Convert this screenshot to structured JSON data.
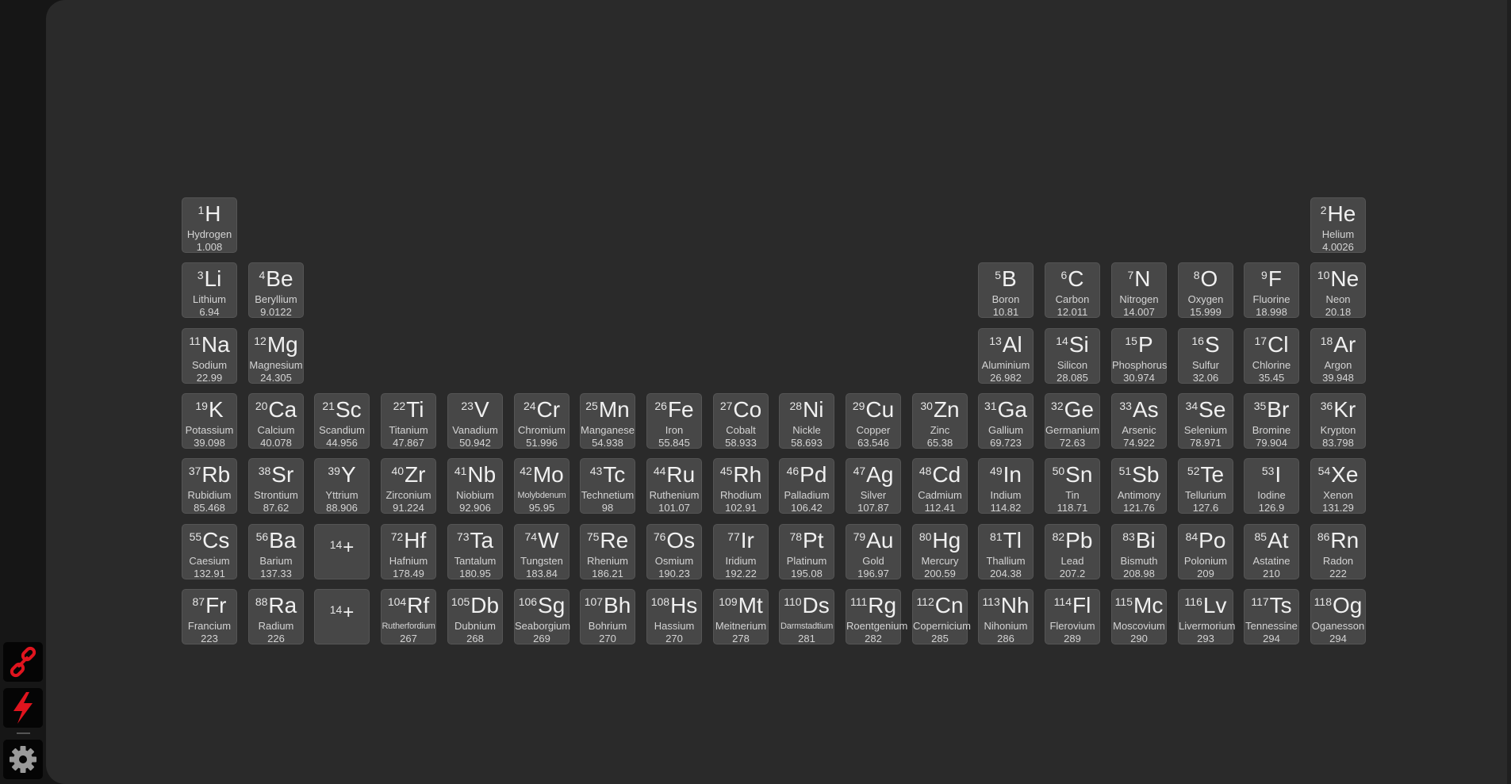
{
  "sidebar": {
    "buttons": [
      {
        "name": "link-button",
        "icon": "link-icon",
        "color": "#e0141e"
      },
      {
        "name": "flash-button",
        "icon": "lightning-icon",
        "color": "#e0141e"
      },
      {
        "name": "settings-button",
        "icon": "gear-icon",
        "color": "#9a9a9a"
      }
    ]
  },
  "colors": {
    "tile_bg": "#474747",
    "page_bg": "#2a2a2a",
    "sidebar_bg": "#161616",
    "accent": "#e0141e"
  },
  "elements": [
    {
      "n": "1",
      "s": "H",
      "name": "Hydrogen",
      "m": "1.008",
      "r": 1,
      "c": 1
    },
    {
      "n": "2",
      "s": "He",
      "name": "Helium",
      "m": "4.0026",
      "r": 1,
      "c": 18
    },
    {
      "n": "3",
      "s": "Li",
      "name": "Lithium",
      "m": "6.94",
      "r": 2,
      "c": 1
    },
    {
      "n": "4",
      "s": "Be",
      "name": "Beryllium",
      "m": "9.0122",
      "r": 2,
      "c": 2
    },
    {
      "n": "5",
      "s": "B",
      "name": "Boron",
      "m": "10.81",
      "r": 2,
      "c": 13
    },
    {
      "n": "6",
      "s": "C",
      "name": "Carbon",
      "m": "12.011",
      "r": 2,
      "c": 14
    },
    {
      "n": "7",
      "s": "N",
      "name": "Nitrogen",
      "m": "14.007",
      "r": 2,
      "c": 15
    },
    {
      "n": "8",
      "s": "O",
      "name": "Oxygen",
      "m": "15.999",
      "r": 2,
      "c": 16
    },
    {
      "n": "9",
      "s": "F",
      "name": "Fluorine",
      "m": "18.998",
      "r": 2,
      "c": 17
    },
    {
      "n": "10",
      "s": "Ne",
      "name": "Neon",
      "m": "20.18",
      "r": 2,
      "c": 18
    },
    {
      "n": "11",
      "s": "Na",
      "name": "Sodium",
      "m": "22.99",
      "r": 3,
      "c": 1
    },
    {
      "n": "12",
      "s": "Mg",
      "name": "Magnesium",
      "m": "24.305",
      "r": 3,
      "c": 2
    },
    {
      "n": "13",
      "s": "Al",
      "name": "Aluminium",
      "m": "26.982",
      "r": 3,
      "c": 13
    },
    {
      "n": "14",
      "s": "Si",
      "name": "Silicon",
      "m": "28.085",
      "r": 3,
      "c": 14
    },
    {
      "n": "15",
      "s": "P",
      "name": "Phosphorus",
      "m": "30.974",
      "r": 3,
      "c": 15
    },
    {
      "n": "16",
      "s": "S",
      "name": "Sulfur",
      "m": "32.06",
      "r": 3,
      "c": 16
    },
    {
      "n": "17",
      "s": "Cl",
      "name": "Chlorine",
      "m": "35.45",
      "r": 3,
      "c": 17
    },
    {
      "n": "18",
      "s": "Ar",
      "name": "Argon",
      "m": "39.948",
      "r": 3,
      "c": 18
    },
    {
      "n": "19",
      "s": "K",
      "name": "Potassium",
      "m": "39.098",
      "r": 4,
      "c": 1
    },
    {
      "n": "20",
      "s": "Ca",
      "name": "Calcium",
      "m": "40.078",
      "r": 4,
      "c": 2
    },
    {
      "n": "21",
      "s": "Sc",
      "name": "Scandium",
      "m": "44.956",
      "r": 4,
      "c": 3
    },
    {
      "n": "22",
      "s": "Ti",
      "name": "Titanium",
      "m": "47.867",
      "r": 4,
      "c": 4
    },
    {
      "n": "23",
      "s": "V",
      "name": "Vanadium",
      "m": "50.942",
      "r": 4,
      "c": 5
    },
    {
      "n": "24",
      "s": "Cr",
      "name": "Chromium",
      "m": "51.996",
      "r": 4,
      "c": 6
    },
    {
      "n": "25",
      "s": "Mn",
      "name": "Manganese",
      "m": "54.938",
      "r": 4,
      "c": 7
    },
    {
      "n": "26",
      "s": "Fe",
      "name": "Iron",
      "m": "55.845",
      "r": 4,
      "c": 8
    },
    {
      "n": "27",
      "s": "Co",
      "name": "Cobalt",
      "m": "58.933",
      "r": 4,
      "c": 9
    },
    {
      "n": "28",
      "s": "Ni",
      "name": "Nickle",
      "m": "58.693",
      "r": 4,
      "c": 10
    },
    {
      "n": "29",
      "s": "Cu",
      "name": "Copper",
      "m": "63.546",
      "r": 4,
      "c": 11
    },
    {
      "n": "30",
      "s": "Zn",
      "name": "Zinc",
      "m": "65.38",
      "r": 4,
      "c": 12
    },
    {
      "n": "31",
      "s": "Ga",
      "name": "Gallium",
      "m": "69.723",
      "r": 4,
      "c": 13
    },
    {
      "n": "32",
      "s": "Ge",
      "name": "Germanium",
      "m": "72.63",
      "r": 4,
      "c": 14
    },
    {
      "n": "33",
      "s": "As",
      "name": "Arsenic",
      "m": "74.922",
      "r": 4,
      "c": 15
    },
    {
      "n": "34",
      "s": "Se",
      "name": "Selenium",
      "m": "78.971",
      "r": 4,
      "c": 16
    },
    {
      "n": "35",
      "s": "Br",
      "name": "Bromine",
      "m": "79.904",
      "r": 4,
      "c": 17
    },
    {
      "n": "36",
      "s": "Kr",
      "name": "Krypton",
      "m": "83.798",
      "r": 4,
      "c": 18
    },
    {
      "n": "37",
      "s": "Rb",
      "name": "Rubidium",
      "m": "85.468",
      "r": 5,
      "c": 1
    },
    {
      "n": "38",
      "s": "Sr",
      "name": "Strontium",
      "m": "87.62",
      "r": 5,
      "c": 2
    },
    {
      "n": "39",
      "s": "Y",
      "name": "Yttrium",
      "m": "88.906",
      "r": 5,
      "c": 3
    },
    {
      "n": "40",
      "s": "Zr",
      "name": "Zirconium",
      "m": "91.224",
      "r": 5,
      "c": 4
    },
    {
      "n": "41",
      "s": "Nb",
      "name": "Niobium",
      "m": "92.906",
      "r": 5,
      "c": 5
    },
    {
      "n": "42",
      "s": "Mo",
      "name": "Molybdenum",
      "m": "95.95",
      "r": 5,
      "c": 6,
      "small": true
    },
    {
      "n": "43",
      "s": "Tc",
      "name": "Technetium",
      "m": "98",
      "r": 5,
      "c": 7
    },
    {
      "n": "44",
      "s": "Ru",
      "name": "Ruthenium",
      "m": "101.07",
      "r": 5,
      "c": 8
    },
    {
      "n": "45",
      "s": "Rh",
      "name": "Rhodium",
      "m": "102.91",
      "r": 5,
      "c": 9
    },
    {
      "n": "46",
      "s": "Pd",
      "name": "Palladium",
      "m": "106.42",
      "r": 5,
      "c": 10
    },
    {
      "n": "47",
      "s": "Ag",
      "name": "Silver",
      "m": "107.87",
      "r": 5,
      "c": 11
    },
    {
      "n": "48",
      "s": "Cd",
      "name": "Cadmium",
      "m": "112.41",
      "r": 5,
      "c": 12
    },
    {
      "n": "49",
      "s": "In",
      "name": "Indium",
      "m": "114.82",
      "r": 5,
      "c": 13
    },
    {
      "n": "50",
      "s": "Sn",
      "name": "Tin",
      "m": "118.71",
      "r": 5,
      "c": 14
    },
    {
      "n": "51",
      "s": "Sb",
      "name": "Antimony",
      "m": "121.76",
      "r": 5,
      "c": 15
    },
    {
      "n": "52",
      "s": "Te",
      "name": "Tellurium",
      "m": "127.6",
      "r": 5,
      "c": 16
    },
    {
      "n": "53",
      "s": "I",
      "name": "Iodine",
      "m": "126.9",
      "r": 5,
      "c": 17
    },
    {
      "n": "54",
      "s": "Xe",
      "name": "Xenon",
      "m": "131.29",
      "r": 5,
      "c": 18
    },
    {
      "n": "55",
      "s": "Cs",
      "name": "Caesium",
      "m": "132.91",
      "r": 6,
      "c": 1
    },
    {
      "n": "56",
      "s": "Ba",
      "name": "Barium",
      "m": "137.33",
      "r": 6,
      "c": 2
    },
    {
      "n": "14",
      "s": "+",
      "name": "",
      "m": "",
      "r": 6,
      "c": 3,
      "placeholder": true
    },
    {
      "n": "72",
      "s": "Hf",
      "name": "Hafnium",
      "m": "178.49",
      "r": 6,
      "c": 4
    },
    {
      "n": "73",
      "s": "Ta",
      "name": "Tantalum",
      "m": "180.95",
      "r": 6,
      "c": 5
    },
    {
      "n": "74",
      "s": "W",
      "name": "Tungsten",
      "m": "183.84",
      "r": 6,
      "c": 6
    },
    {
      "n": "75",
      "s": "Re",
      "name": "Rhenium",
      "m": "186.21",
      "r": 6,
      "c": 7
    },
    {
      "n": "76",
      "s": "Os",
      "name": "Osmium",
      "m": "190.23",
      "r": 6,
      "c": 8
    },
    {
      "n": "77",
      "s": "Ir",
      "name": "Iridium",
      "m": "192.22",
      "r": 6,
      "c": 9
    },
    {
      "n": "78",
      "s": "Pt",
      "name": "Platinum",
      "m": "195.08",
      "r": 6,
      "c": 10
    },
    {
      "n": "79",
      "s": "Au",
      "name": "Gold",
      "m": "196.97",
      "r": 6,
      "c": 11
    },
    {
      "n": "80",
      "s": "Hg",
      "name": "Mercury",
      "m": "200.59",
      "r": 6,
      "c": 12
    },
    {
      "n": "81",
      "s": "Tl",
      "name": "Thallium",
      "m": "204.38",
      "r": 6,
      "c": 13
    },
    {
      "n": "82",
      "s": "Pb",
      "name": "Lead",
      "m": "207.2",
      "r": 6,
      "c": 14
    },
    {
      "n": "83",
      "s": "Bi",
      "name": "Bismuth",
      "m": "208.98",
      "r": 6,
      "c": 15
    },
    {
      "n": "84",
      "s": "Po",
      "name": "Polonium",
      "m": "209",
      "r": 6,
      "c": 16
    },
    {
      "n": "85",
      "s": "At",
      "name": "Astatine",
      "m": "210",
      "r": 6,
      "c": 17
    },
    {
      "n": "86",
      "s": "Rn",
      "name": "Radon",
      "m": "222",
      "r": 6,
      "c": 18
    },
    {
      "n": "87",
      "s": "Fr",
      "name": "Francium",
      "m": "223",
      "r": 7,
      "c": 1
    },
    {
      "n": "88",
      "s": "Ra",
      "name": "Radium",
      "m": "226",
      "r": 7,
      "c": 2
    },
    {
      "n": "14",
      "s": "+",
      "name": "",
      "m": "",
      "r": 7,
      "c": 3,
      "placeholder": true
    },
    {
      "n": "104",
      "s": "Rf",
      "name": "Rutherfordium",
      "m": "267",
      "r": 7,
      "c": 4,
      "small": true
    },
    {
      "n": "105",
      "s": "Db",
      "name": "Dubnium",
      "m": "268",
      "r": 7,
      "c": 5
    },
    {
      "n": "106",
      "s": "Sg",
      "name": "Seaborgium",
      "m": "269",
      "r": 7,
      "c": 6
    },
    {
      "n": "107",
      "s": "Bh",
      "name": "Bohrium",
      "m": "270",
      "r": 7,
      "c": 7
    },
    {
      "n": "108",
      "s": "Hs",
      "name": "Hassium",
      "m": "270",
      "r": 7,
      "c": 8
    },
    {
      "n": "109",
      "s": "Mt",
      "name": "Meitnerium",
      "m": "278",
      "r": 7,
      "c": 9
    },
    {
      "n": "110",
      "s": "Ds",
      "name": "Darmstadtium",
      "m": "281",
      "r": 7,
      "c": 10,
      "small": true
    },
    {
      "n": "111",
      "s": "Rg",
      "name": "Roentgenium",
      "m": "282",
      "r": 7,
      "c": 11
    },
    {
      "n": "112",
      "s": "Cn",
      "name": "Copernicium",
      "m": "285",
      "r": 7,
      "c": 12
    },
    {
      "n": "113",
      "s": "Nh",
      "name": "Nihonium",
      "m": "286",
      "r": 7,
      "c": 13
    },
    {
      "n": "114",
      "s": "Fl",
      "name": "Flerovium",
      "m": "289",
      "r": 7,
      "c": 14
    },
    {
      "n": "115",
      "s": "Mc",
      "name": "Moscovium",
      "m": "290",
      "r": 7,
      "c": 15
    },
    {
      "n": "116",
      "s": "Lv",
      "name": "Livermorium",
      "m": "293",
      "r": 7,
      "c": 16
    },
    {
      "n": "117",
      "s": "Ts",
      "name": "Tennessine",
      "m": "294",
      "r": 7,
      "c": 17
    },
    {
      "n": "118",
      "s": "Og",
      "name": "Oganesson",
      "m": "294",
      "r": 7,
      "c": 18
    }
  ]
}
